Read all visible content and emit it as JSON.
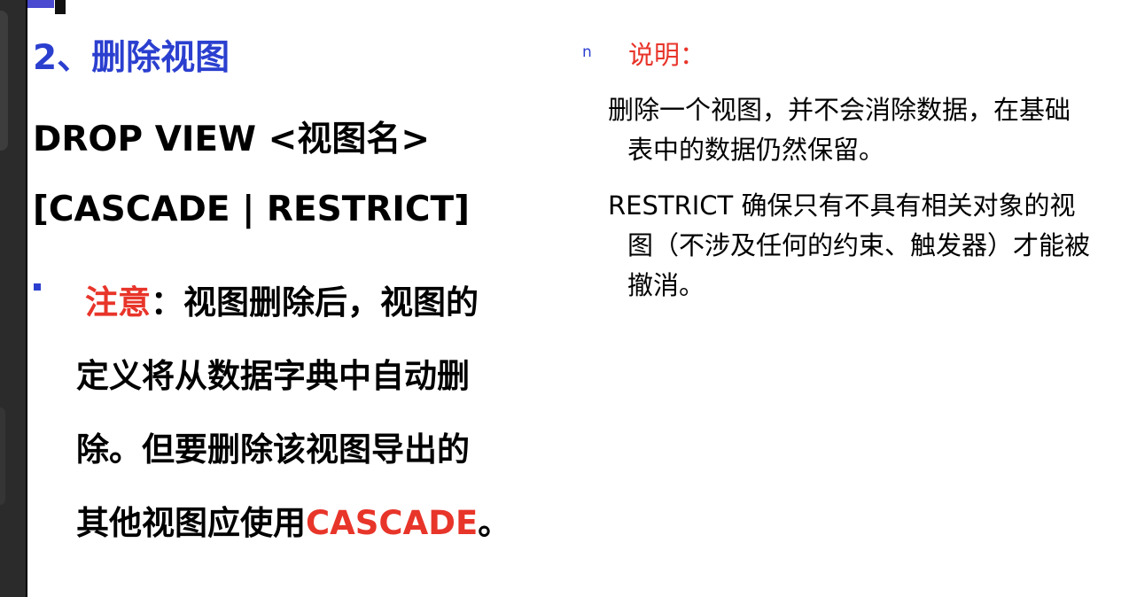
{
  "left": {
    "title": "2、删除视图",
    "code_line1": "DROP VIEW <视图名>",
    "code_line2": "[CASCADE | RESTRICT]",
    "note_label": "注意",
    "note_colon": "：",
    "note_first_line": "视图删除后，视图的",
    "note_line2": "定义将从数据字典中自动删",
    "note_line3": "除。但要删除该视图导出的",
    "note_line4_prefix": "其他视图应使用",
    "note_line4_keyword": "CASCADE",
    "note_line4_suffix": "。"
  },
  "right": {
    "bullet_marker": "n",
    "heading": "说明：",
    "para1_line1": "删除一个视图，并不会消除数据，在基础",
    "para1_line2": "表中的数据仍然保留。",
    "para2_line1": "RESTRICT 确保只有不具有相关对象的视",
    "para2_line2": "图（不涉及任何的约束、触发器）才能被",
    "para2_line3": "撤消。"
  },
  "colors": {
    "title_blue": "#2b3fcf",
    "accent_red": "#e8352a",
    "chrome_dark": "#2b2b2b"
  }
}
